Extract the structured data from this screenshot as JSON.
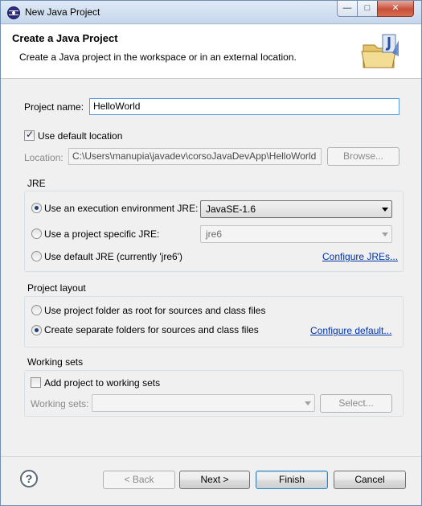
{
  "window": {
    "title": "New Java Project",
    "controls": {
      "minimize": "—",
      "maximize": "□",
      "close": "✕"
    }
  },
  "header": {
    "title": "Create a Java Project",
    "description": "Create a Java project in the workspace or in an external location."
  },
  "project": {
    "name_label": "Project name:",
    "name_value": "HelloWorld",
    "use_default_location_label": "Use default location",
    "use_default_location_checked": true,
    "location_label": "Location:",
    "location_value": "C:\\Users\\manupia\\javadev\\corsoJavaDevApp\\HelloWorld",
    "browse_label": "Browse..."
  },
  "jre": {
    "group_title": "JRE",
    "option_env_label": "Use an execution environment JRE:",
    "option_env_value": "JavaSE-1.6",
    "option_specific_label": "Use a project specific JRE:",
    "option_specific_value": "jre6",
    "option_default_label": "Use default JRE (currently 'jre6')",
    "configure_link": "Configure JREs..."
  },
  "layout": {
    "group_title": "Project layout",
    "option_root_label": "Use project folder as root for sources and class files",
    "option_separate_label": "Create separate folders for sources and class files",
    "configure_link": "Configure default..."
  },
  "working_sets": {
    "group_title": "Working sets",
    "add_label": "Add project to working sets",
    "sets_label": "Working sets:",
    "sets_value": "",
    "select_label": "Select..."
  },
  "footer": {
    "help_symbol": "?",
    "back_label": "< Back",
    "next_label": "Next >",
    "finish_label": "Finish",
    "cancel_label": "Cancel"
  },
  "colors": {
    "link": "#0033a8",
    "header_bg": "#ffffff",
    "dialog_bg": "#f0f0f0",
    "title_bar": "#dfe9f5"
  }
}
